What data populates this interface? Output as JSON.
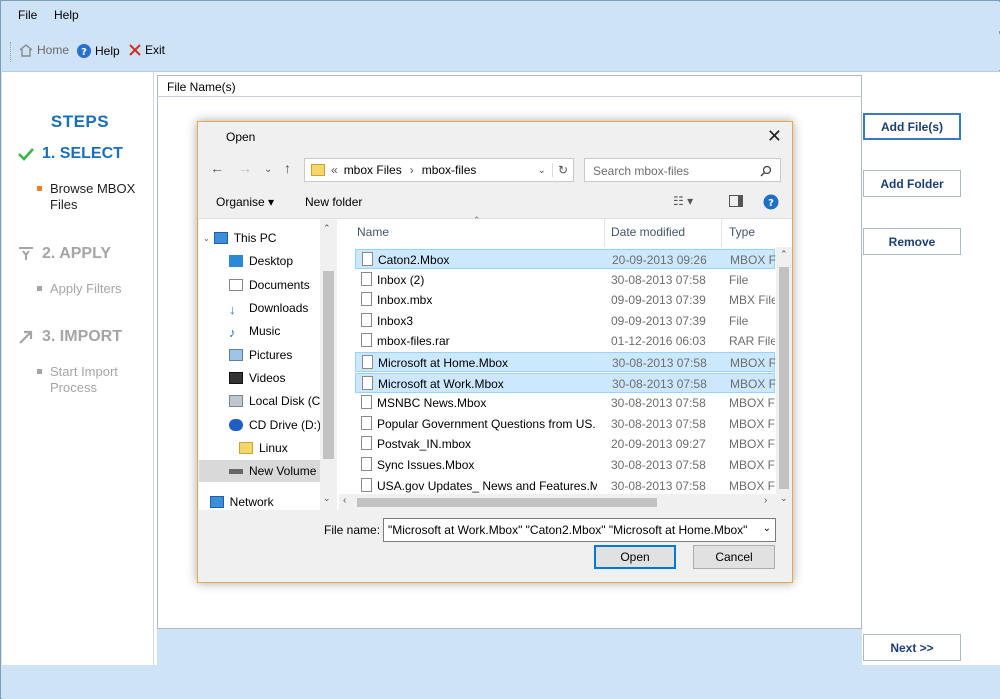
{
  "menu": {
    "file": "File",
    "help": "Help"
  },
  "toolbar": {
    "home": "Home",
    "help": "Help",
    "exit": "Exit"
  },
  "steps": {
    "title": "STEPS",
    "step1": "1. SELECT",
    "step1_sub": "Browse MBOX Files",
    "step2": "2. APPLY",
    "step2_sub": "Apply Filters",
    "step3": "3. IMPORT",
    "step3_sub": "Start Import Process"
  },
  "file_list": {
    "header": "File Name(s)"
  },
  "buttons": {
    "add_files": "Add File(s)",
    "add_folder": "Add Folder",
    "remove": "Remove",
    "next": "Next >>"
  },
  "dialog": {
    "title": "Open",
    "close": "✕",
    "breadcrumb": {
      "chevron": "«",
      "crumb1": "mbox Files",
      "sep": "›",
      "crumb2": "mbox-files"
    },
    "search_placeholder": "Search mbox-files",
    "organise": "Organise ▾",
    "new_folder": "New folder",
    "tree": [
      "This PC",
      "Desktop",
      "Documents",
      "Downloads",
      "Music",
      "Pictures",
      "Videos",
      "Local Disk (C:",
      "CD Drive (D:)",
      "Linux",
      "New Volume",
      "Network"
    ],
    "columns": {
      "name": "Name",
      "date": "Date modified",
      "type": "Type"
    },
    "files": [
      {
        "name": "Caton2.Mbox",
        "date": "20-09-2013 09:26",
        "type": "MBOX Fil"
      },
      {
        "name": "Inbox (2)",
        "date": "30-08-2013 07:58",
        "type": "File"
      },
      {
        "name": "Inbox.mbx",
        "date": "09-09-2013 07:39",
        "type": "MBX File"
      },
      {
        "name": "Inbox3",
        "date": "09-09-2013 07:39",
        "type": "File"
      },
      {
        "name": "mbox-files.rar",
        "date": "01-12-2016 06:03",
        "type": "RAR File"
      },
      {
        "name": "Microsoft at Home.Mbox",
        "date": "30-08-2013 07:58",
        "type": "MBOX Fil"
      },
      {
        "name": "Microsoft at Work.Mbox",
        "date": "30-08-2013 07:58",
        "type": "MBOX Fil"
      },
      {
        "name": "MSNBC News.Mbox",
        "date": "30-08-2013 07:58",
        "type": "MBOX Fil"
      },
      {
        "name": "Popular Government Questions from US...",
        "date": "30-08-2013 07:58",
        "type": "MBOX Fil"
      },
      {
        "name": "Postvak_IN.mbox",
        "date": "20-09-2013 09:27",
        "type": "MBOX Fil"
      },
      {
        "name": "Sync Issues.Mbox",
        "date": "30-08-2013 07:58",
        "type": "MBOX Fil"
      },
      {
        "name": "USA.gov Updates_ News and Features.M...",
        "date": "30-08-2013 07:58",
        "type": "MBOX Fil"
      }
    ],
    "file_name_label": "File name:",
    "file_name_value": "\"Microsoft at Work.Mbox\" \"Caton2.Mbox\" \"Microsoft at Home.Mbox\"",
    "open": "Open",
    "cancel": "Cancel"
  }
}
